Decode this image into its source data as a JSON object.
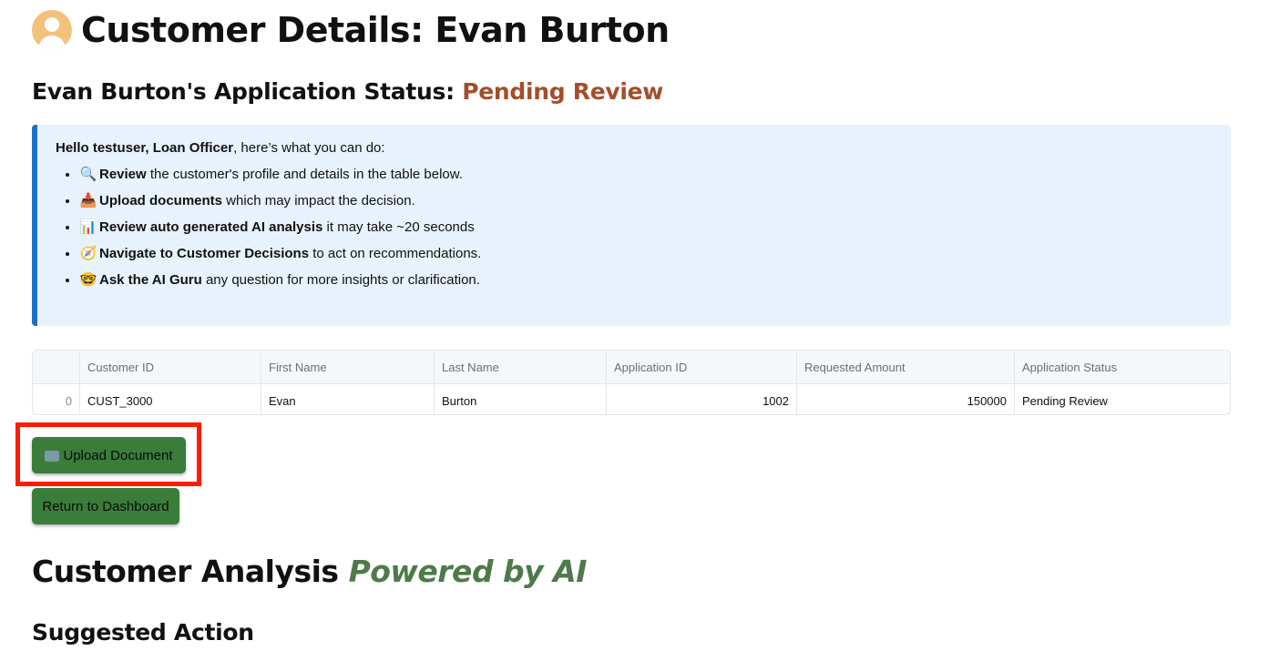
{
  "header": {
    "title": "Customer Details: Evan Burton",
    "avatar_icon": "user-circle-icon"
  },
  "status": {
    "prefix": "Evan Burton's Application Status:",
    "value": "Pending Review",
    "value_color": "#a34e2a"
  },
  "info": {
    "greeting_bold": "Hello testuser, Loan Officer",
    "greeting_rest": ", here’s what you can do:",
    "items": [
      {
        "icon": "🔍",
        "icon_name": "magnifier-icon",
        "bold": "Review",
        "rest": " the customer's profile and details in the table below."
      },
      {
        "icon": "📥",
        "icon_name": "inbox-tray-icon",
        "bold": "Upload documents",
        "rest": " which may impact the decision."
      },
      {
        "icon": "📊",
        "icon_name": "bar-chart-icon",
        "bold": "Review auto generated AI analysis",
        "rest": " it may take ~20 seconds"
      },
      {
        "icon": "🧭",
        "icon_name": "compass-icon",
        "bold": "Navigate to Customer Decisions",
        "rest": " to act on recommendations."
      },
      {
        "icon": "🤓",
        "icon_name": "nerd-face-icon",
        "bold": "Ask the AI Guru",
        "rest": " any question for more insights or clarification."
      }
    ]
  },
  "table": {
    "columns": [
      "",
      "Customer ID",
      "First Name",
      "Last Name",
      "Application ID",
      "Requested Amount",
      "Application Status"
    ],
    "rows": [
      [
        "0",
        "CUST_3000",
        "Evan",
        "Burton",
        "1002",
        "150000",
        "Pending Review"
      ]
    ]
  },
  "buttons": {
    "upload_label": "Upload Document",
    "upload_icon": "folder-icon",
    "return_label": "Return to Dashboard"
  },
  "analysis": {
    "title": "Customer Analysis",
    "title_accent": "Powered by AI",
    "accent_color": "#4e7a4a",
    "suggested_heading": "Suggested Action"
  },
  "colors": {
    "button_bg": "#3a7d3a",
    "info_bg": "#e8f2fc",
    "info_border": "#1f6fc7",
    "highlight": "#ff1a00"
  }
}
